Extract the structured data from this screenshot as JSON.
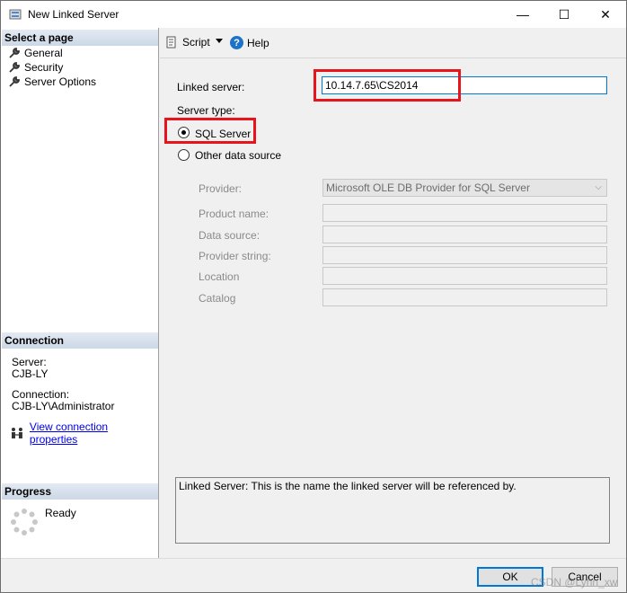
{
  "window": {
    "title": "New Linked Server",
    "min_glyph": "—",
    "max_glyph": "☐",
    "close_glyph": "✕"
  },
  "left": {
    "select_page_header": "Select a page",
    "pages": [
      {
        "label": "General",
        "icon": "wrench-icon"
      },
      {
        "label": "Security",
        "icon": "wrench-icon"
      },
      {
        "label": "Server Options",
        "icon": "wrench-icon"
      }
    ],
    "connection_header": "Connection",
    "server_label": "Server:",
    "server_value": "CJB-LY",
    "connection_label": "Connection:",
    "connection_value": "CJB-LY\\Administrator",
    "view_connection_link": "View connection properties",
    "progress_header": "Progress",
    "progress_status": "Ready"
  },
  "toolbar": {
    "script_label": "Script",
    "help_label": "Help"
  },
  "form": {
    "linked_server_label": "Linked server:",
    "linked_server_value": "10.14.7.65\\CS2014",
    "server_type_label": "Server type:",
    "sql_server_label": "SQL Server",
    "other_source_label": "Other data source",
    "provider_label": "Provider:",
    "provider_value": "Microsoft OLE DB Provider for SQL Server",
    "product_name_label": "Product name:",
    "data_source_label": "Data source:",
    "provider_string_label": "Provider string:",
    "location_label": "Location",
    "catalog_label": "Catalog",
    "description": "Linked Server: This is the name the linked server will be referenced by."
  },
  "footer": {
    "ok_label": "OK",
    "cancel_label": "Cancel",
    "watermark": "CSDN @Lynn_xw"
  },
  "colors": {
    "highlight": "#e8141b",
    "focus": "#0078d7",
    "link": "#0000ee"
  }
}
